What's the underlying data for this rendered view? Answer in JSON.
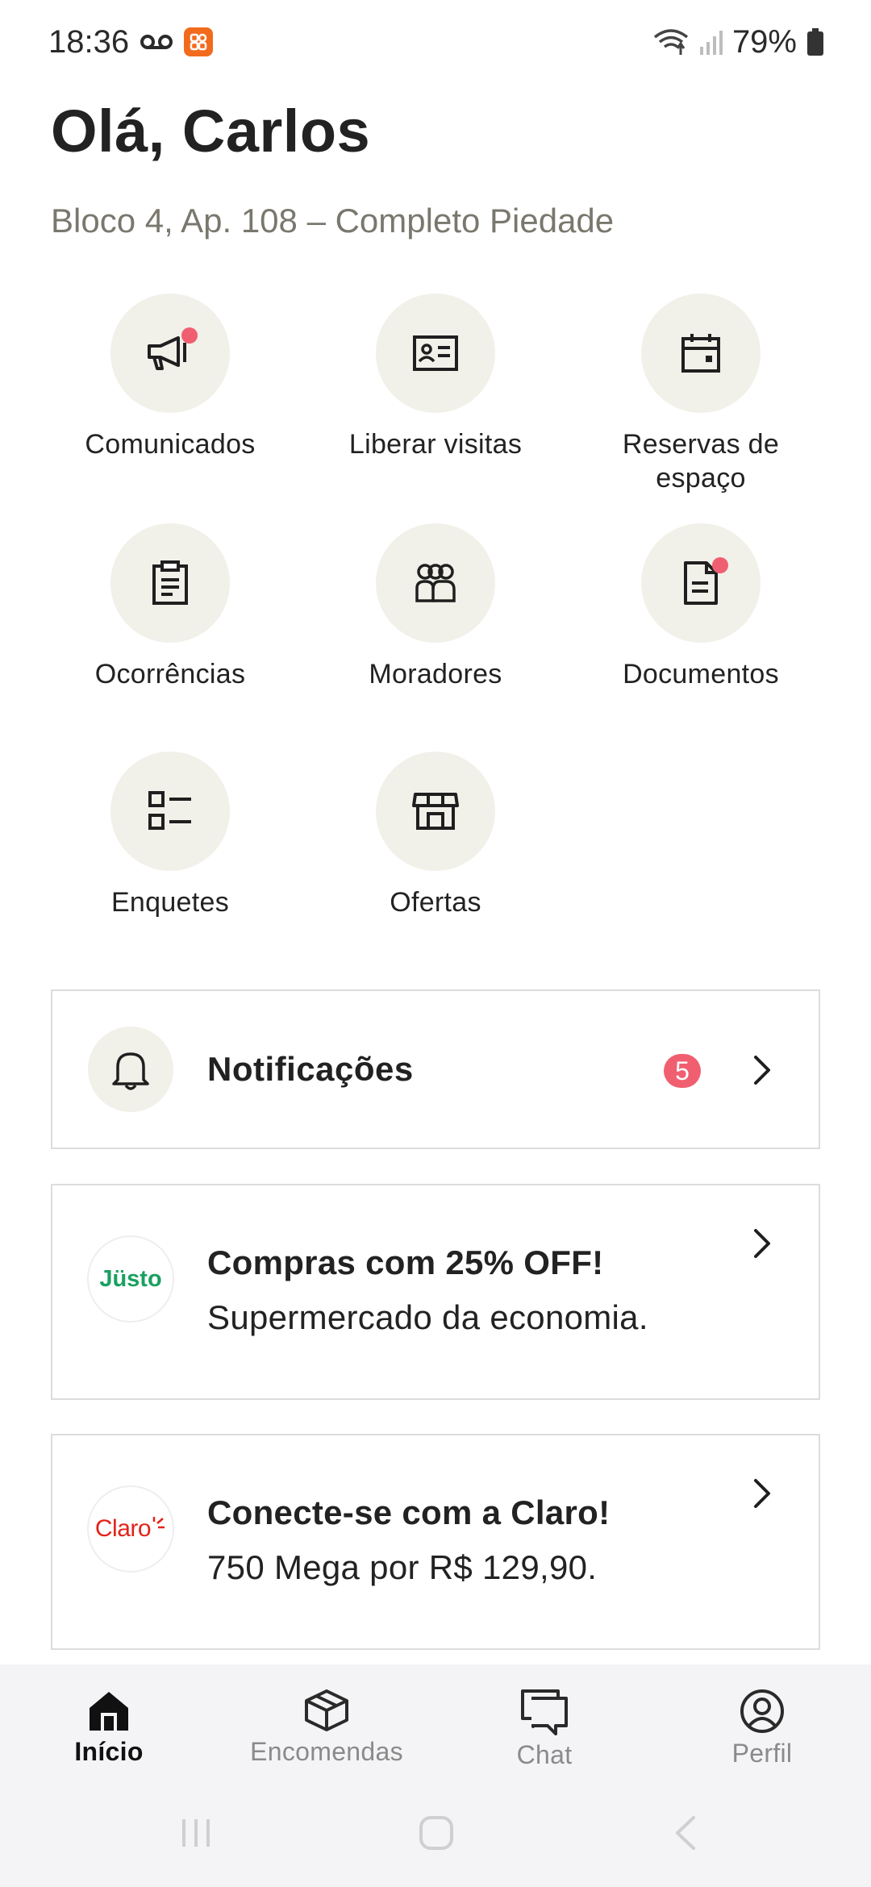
{
  "status_bar": {
    "time": "18:36",
    "battery": "79%"
  },
  "header": {
    "greeting": "Olá, Carlos",
    "address": "Bloco 4, Ap. 108 – Completo Piedade"
  },
  "grid": [
    {
      "label": "Comunicados",
      "icon": "megaphone-icon",
      "has_dot": true
    },
    {
      "label": "Liberar visitas",
      "icon": "id-card-icon",
      "has_dot": false
    },
    {
      "label": "Reservas de espaço",
      "icon": "calendar-icon",
      "has_dot": false
    },
    {
      "label": "Ocorrências",
      "icon": "clipboard-icon",
      "has_dot": false
    },
    {
      "label": "Moradores",
      "icon": "people-icon",
      "has_dot": false
    },
    {
      "label": "Documentos",
      "icon": "document-icon",
      "has_dot": true
    },
    {
      "label": "Enquetes",
      "icon": "list-icon",
      "has_dot": false
    },
    {
      "label": "Ofertas",
      "icon": "store-icon",
      "has_dot": false
    }
  ],
  "notifications": {
    "title": "Notificações",
    "count": "5"
  },
  "promos": [
    {
      "logo": "Jüsto",
      "title": "Compras com 25% OFF!",
      "subtitle": "Supermercado da economia.",
      "logo_color": "#1aa060"
    },
    {
      "logo": "Claro",
      "title": "Conecte-se com a Claro!",
      "subtitle": "750 Mega por R$ 129,90.",
      "logo_color": "#e2231a"
    }
  ],
  "nav": [
    {
      "label": "Início",
      "icon": "home-icon",
      "active": true
    },
    {
      "label": "Encomendas",
      "icon": "package-icon",
      "active": false
    },
    {
      "label": "Chat",
      "icon": "chat-icon",
      "active": false
    },
    {
      "label": "Perfil",
      "icon": "profile-icon",
      "active": false
    }
  ],
  "colors": {
    "accent_dot": "#f05f70",
    "circle_bg": "#f1f0e9",
    "text_muted": "#7a786e"
  }
}
